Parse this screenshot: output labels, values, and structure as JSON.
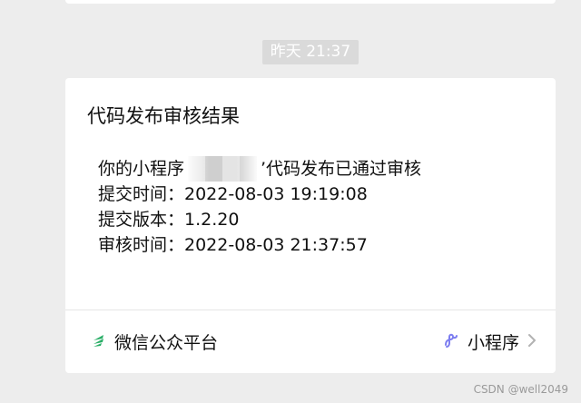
{
  "timestamp": "昨天 21:37",
  "card": {
    "title": "代码发布审核结果",
    "lines": {
      "program_prefix": "你的小程序",
      "program_suffix": "’代码发布已通过审核",
      "submit_time": "提交时间：2022-08-03 19:19:08",
      "submit_version": "提交版本：1.2.20",
      "review_time": "审核时间：2022-08-03 21:37:57"
    }
  },
  "footer": {
    "source": "微信公众平台",
    "mini_program": "小程序"
  },
  "icons": {
    "source": "wechat-platform-icon",
    "mini_program": "mini-program-icon",
    "chevron": "chevron-right-icon"
  },
  "colors": {
    "brand_green": "#2aae67",
    "mini_program_purple": "#7d7ef0"
  },
  "watermark": "CSDN @well2049"
}
